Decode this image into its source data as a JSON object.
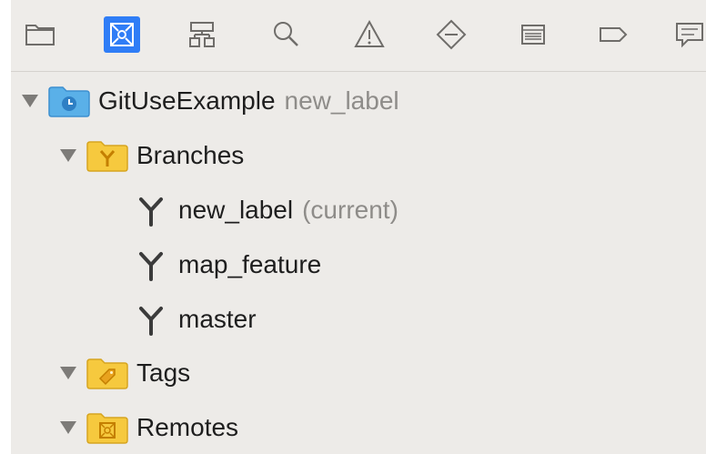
{
  "toolbar": {
    "icons": [
      {
        "name": "project-navigator-icon",
        "selected": false
      },
      {
        "name": "source-control-navigator-icon",
        "selected": true
      },
      {
        "name": "symbol-navigator-icon",
        "selected": false
      },
      {
        "name": "find-navigator-icon",
        "selected": false
      },
      {
        "name": "issue-navigator-icon",
        "selected": false
      },
      {
        "name": "test-navigator-icon",
        "selected": false
      },
      {
        "name": "debug-navigator-icon",
        "selected": false
      },
      {
        "name": "breakpoint-navigator-icon",
        "selected": false
      },
      {
        "name": "report-navigator-icon",
        "selected": false
      }
    ]
  },
  "tree": {
    "repo": {
      "name": "GitUseExample",
      "branch_hint": "new_label"
    },
    "branches_label": "Branches",
    "branches": [
      {
        "name": "new_label",
        "suffix": "(current)"
      },
      {
        "name": "map_feature",
        "suffix": ""
      },
      {
        "name": "master",
        "suffix": ""
      }
    ],
    "tags_label": "Tags",
    "remotes_label": "Remotes"
  },
  "colors": {
    "selected_blue": "#2f7df6",
    "folder_yellow": "#f6c93e",
    "repo_blue": "#5ab0e8"
  }
}
